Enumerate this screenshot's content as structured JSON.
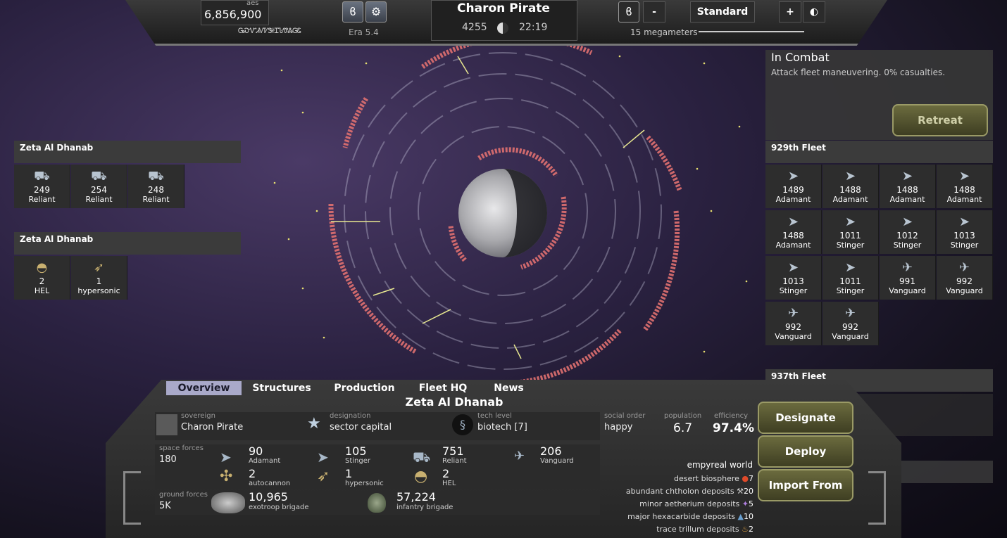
{
  "topbar": {
    "aes_label": "aes",
    "aes_value": "6,856,900",
    "glyphs": "ᏀᏍᏉᏗᏙᏤᏕᏐᏆᏖᏡᏜᏀᏋ",
    "era": "Era 5.4",
    "player_name": "Charon Pirate",
    "score": "4255",
    "time": "22:19",
    "minus_label": "-",
    "mode_label": "Standard",
    "plus_label": "+",
    "scale_label": "15 megameters"
  },
  "left_panels": [
    {
      "title": "Zeta Al Dhanab",
      "units": [
        {
          "count": "249",
          "name": "Reliant",
          "icon": "reliant-ship-icon"
        },
        {
          "count": "254",
          "name": "Reliant",
          "icon": "reliant-ship-icon"
        },
        {
          "count": "248",
          "name": "Reliant",
          "icon": "reliant-ship-icon"
        }
      ]
    },
    {
      "title": "Zeta Al Dhanab",
      "units": [
        {
          "count": "2",
          "name": "HEL",
          "icon": "hel-icon"
        },
        {
          "count": "1",
          "name": "hypersonic",
          "icon": "hypersonic-icon"
        }
      ]
    }
  ],
  "combat": {
    "title": "In Combat",
    "status": "Attack fleet maneuvering. 0% casualties.",
    "retreat_label": "Retreat"
  },
  "fleet_929": {
    "title": "929th Fleet",
    "units": [
      {
        "count": "1489",
        "name": "Adamant"
      },
      {
        "count": "1488",
        "name": "Adamant"
      },
      {
        "count": "1488",
        "name": "Adamant"
      },
      {
        "count": "1488",
        "name": "Adamant"
      },
      {
        "count": "1488",
        "name": "Adamant"
      },
      {
        "count": "1011",
        "name": "Stinger"
      },
      {
        "count": "1012",
        "name": "Stinger"
      },
      {
        "count": "1013",
        "name": "Stinger"
      },
      {
        "count": "1013",
        "name": "Stinger"
      },
      {
        "count": "1011",
        "name": "Stinger"
      },
      {
        "count": "991",
        "name": "Vanguard"
      },
      {
        "count": "992",
        "name": "Vanguard"
      },
      {
        "count": "992",
        "name": "Vanguard"
      },
      {
        "count": "992",
        "name": "Vanguard"
      }
    ]
  },
  "fleet_937": {
    "title": "937th Fleet"
  },
  "bottom": {
    "tabs": [
      "Overview",
      "Structures",
      "Production",
      "Fleet HQ",
      "News"
    ],
    "planet_name": "Zeta Al Dhanab",
    "sovereign_cap": "sovereign",
    "sovereign": "Charon Pirate",
    "designation_cap": "designation",
    "designation": "sector capital",
    "tech_cap": "tech level",
    "tech": "biotech [7]",
    "social_cap": "social order",
    "social": "happy",
    "population_cap": "population",
    "population": "6.7",
    "efficiency_cap": "efficiency",
    "efficiency": "97.4%",
    "space_cap": "space forces",
    "space_total": "180",
    "space_units": [
      {
        "count": "90",
        "name": "Adamant"
      },
      {
        "count": "105",
        "name": "Stinger"
      },
      {
        "count": "751",
        "name": "Reliant"
      },
      {
        "count": "206",
        "name": "Vanguard"
      },
      {
        "count": "2",
        "name": "autocannon"
      },
      {
        "count": "1",
        "name": "hypersonic"
      },
      {
        "count": "2",
        "name": "HEL"
      }
    ],
    "ground_cap": "ground forces",
    "ground_total": "5K",
    "ground_units": [
      {
        "count": "10,965",
        "name": "exotroop brigade"
      },
      {
        "count": "57,224",
        "name": "infantry brigade"
      }
    ],
    "world_type": "empyreal world",
    "resources": [
      {
        "label": "desert biosphere",
        "value": "7"
      },
      {
        "label": "abundant chtholon deposits",
        "value": "20"
      },
      {
        "label": "minor aetherium deposits",
        "value": "5"
      },
      {
        "label": "major hexacarbide deposits",
        "value": "10"
      },
      {
        "label": "trace trillum deposits",
        "value": "2"
      }
    ],
    "designate_label": "Designate",
    "deploy_label": "Deploy",
    "import_label": "Import From"
  }
}
